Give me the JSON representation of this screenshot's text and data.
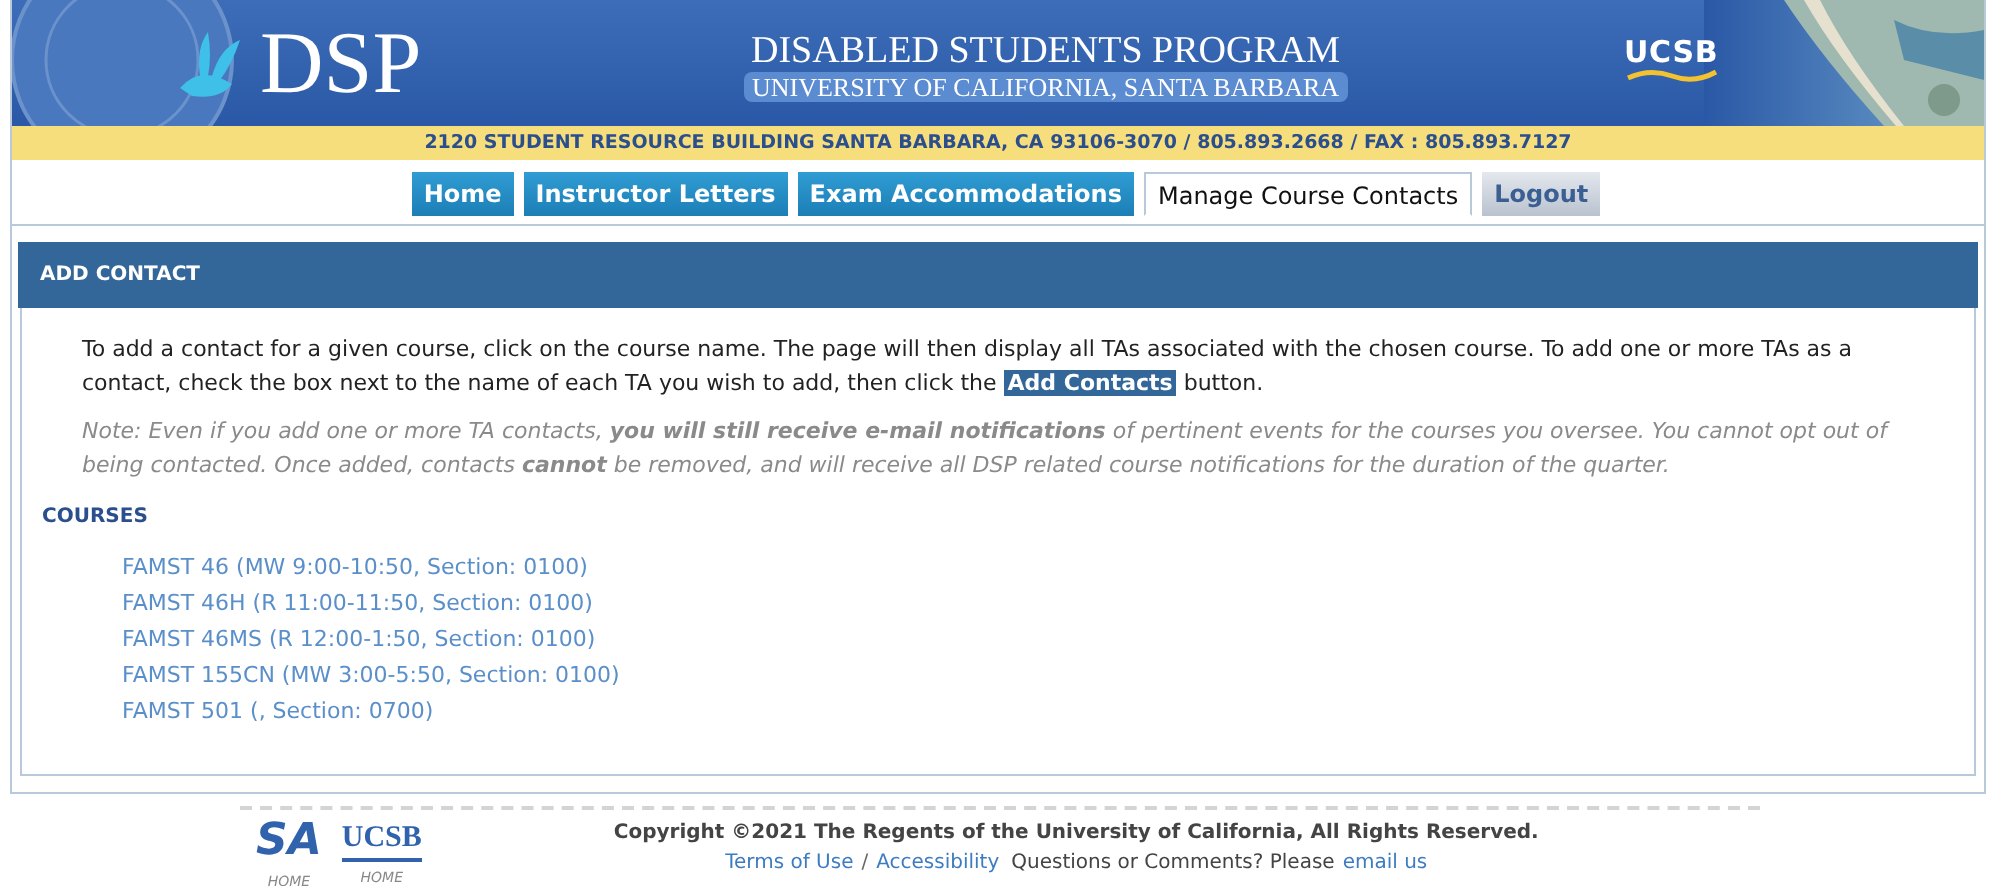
{
  "header": {
    "logo": "DSP",
    "title": "DISABLED STUDENTS PROGRAM",
    "subtitle": "UNIVERSITY OF CALIFORNIA, SANTA BARBARA",
    "right_logo": "UCSB"
  },
  "address": "2120 STUDENT RESOURCE BUILDING SANTA BARBARA, CA 93106-3070 / 805.893.2668 / FAX : 805.893.7127",
  "tabs": [
    {
      "label": "Home",
      "selected": false,
      "kind": "nav"
    },
    {
      "label": "Instructor Letters",
      "selected": false,
      "kind": "nav"
    },
    {
      "label": "Exam Accommodations",
      "selected": false,
      "kind": "nav"
    },
    {
      "label": "Manage Course Contacts",
      "selected": true,
      "kind": "nav"
    },
    {
      "label": "Logout",
      "selected": false,
      "kind": "logout"
    }
  ],
  "panel": {
    "title": "ADD CONTACT",
    "instructions": {
      "before": "To add a contact for a given course, click on the course name. The page will then display all TAs associated with the chosen course. To add one or more TAs as a contact, check the box next to the name of each TA you wish to add, then click the",
      "highlight": "Add Contacts",
      "after": "button."
    },
    "note": "Note: Even if you add one or more TA contacts, **you will still receive e-mail notifications** of pertinent events for the courses you oversee. You cannot opt out of being contacted.  Once added, contacts **cannot** be removed, and will receive all DSP related course notifications for the duration of the quarter.",
    "courses_heading": "COURSES",
    "courses": [
      "FAMST 46 (MW 9:00-10:50, Section: 0100)",
      "FAMST 46H (R 11:00-11:50, Section: 0100)",
      "FAMST 46MS (R 12:00-1:50, Section: 0100)",
      "FAMST 155CN (MW 3:00-5:50, Section: 0100)",
      "FAMST 501 (, Section: 0700)"
    ]
  },
  "footer": {
    "logos": [
      {
        "mark": "SA",
        "caption": "HOME"
      },
      {
        "mark": "UCSB",
        "caption": "HOME"
      }
    ],
    "copyright": "Copyright ©2021 The Regents of the University of California, All Rights Reserved.",
    "links": [
      "Terms of Use",
      "Accessibility"
    ],
    "separator": "/",
    "question": "Questions or Comments? Please",
    "contact_link": "email us"
  }
}
